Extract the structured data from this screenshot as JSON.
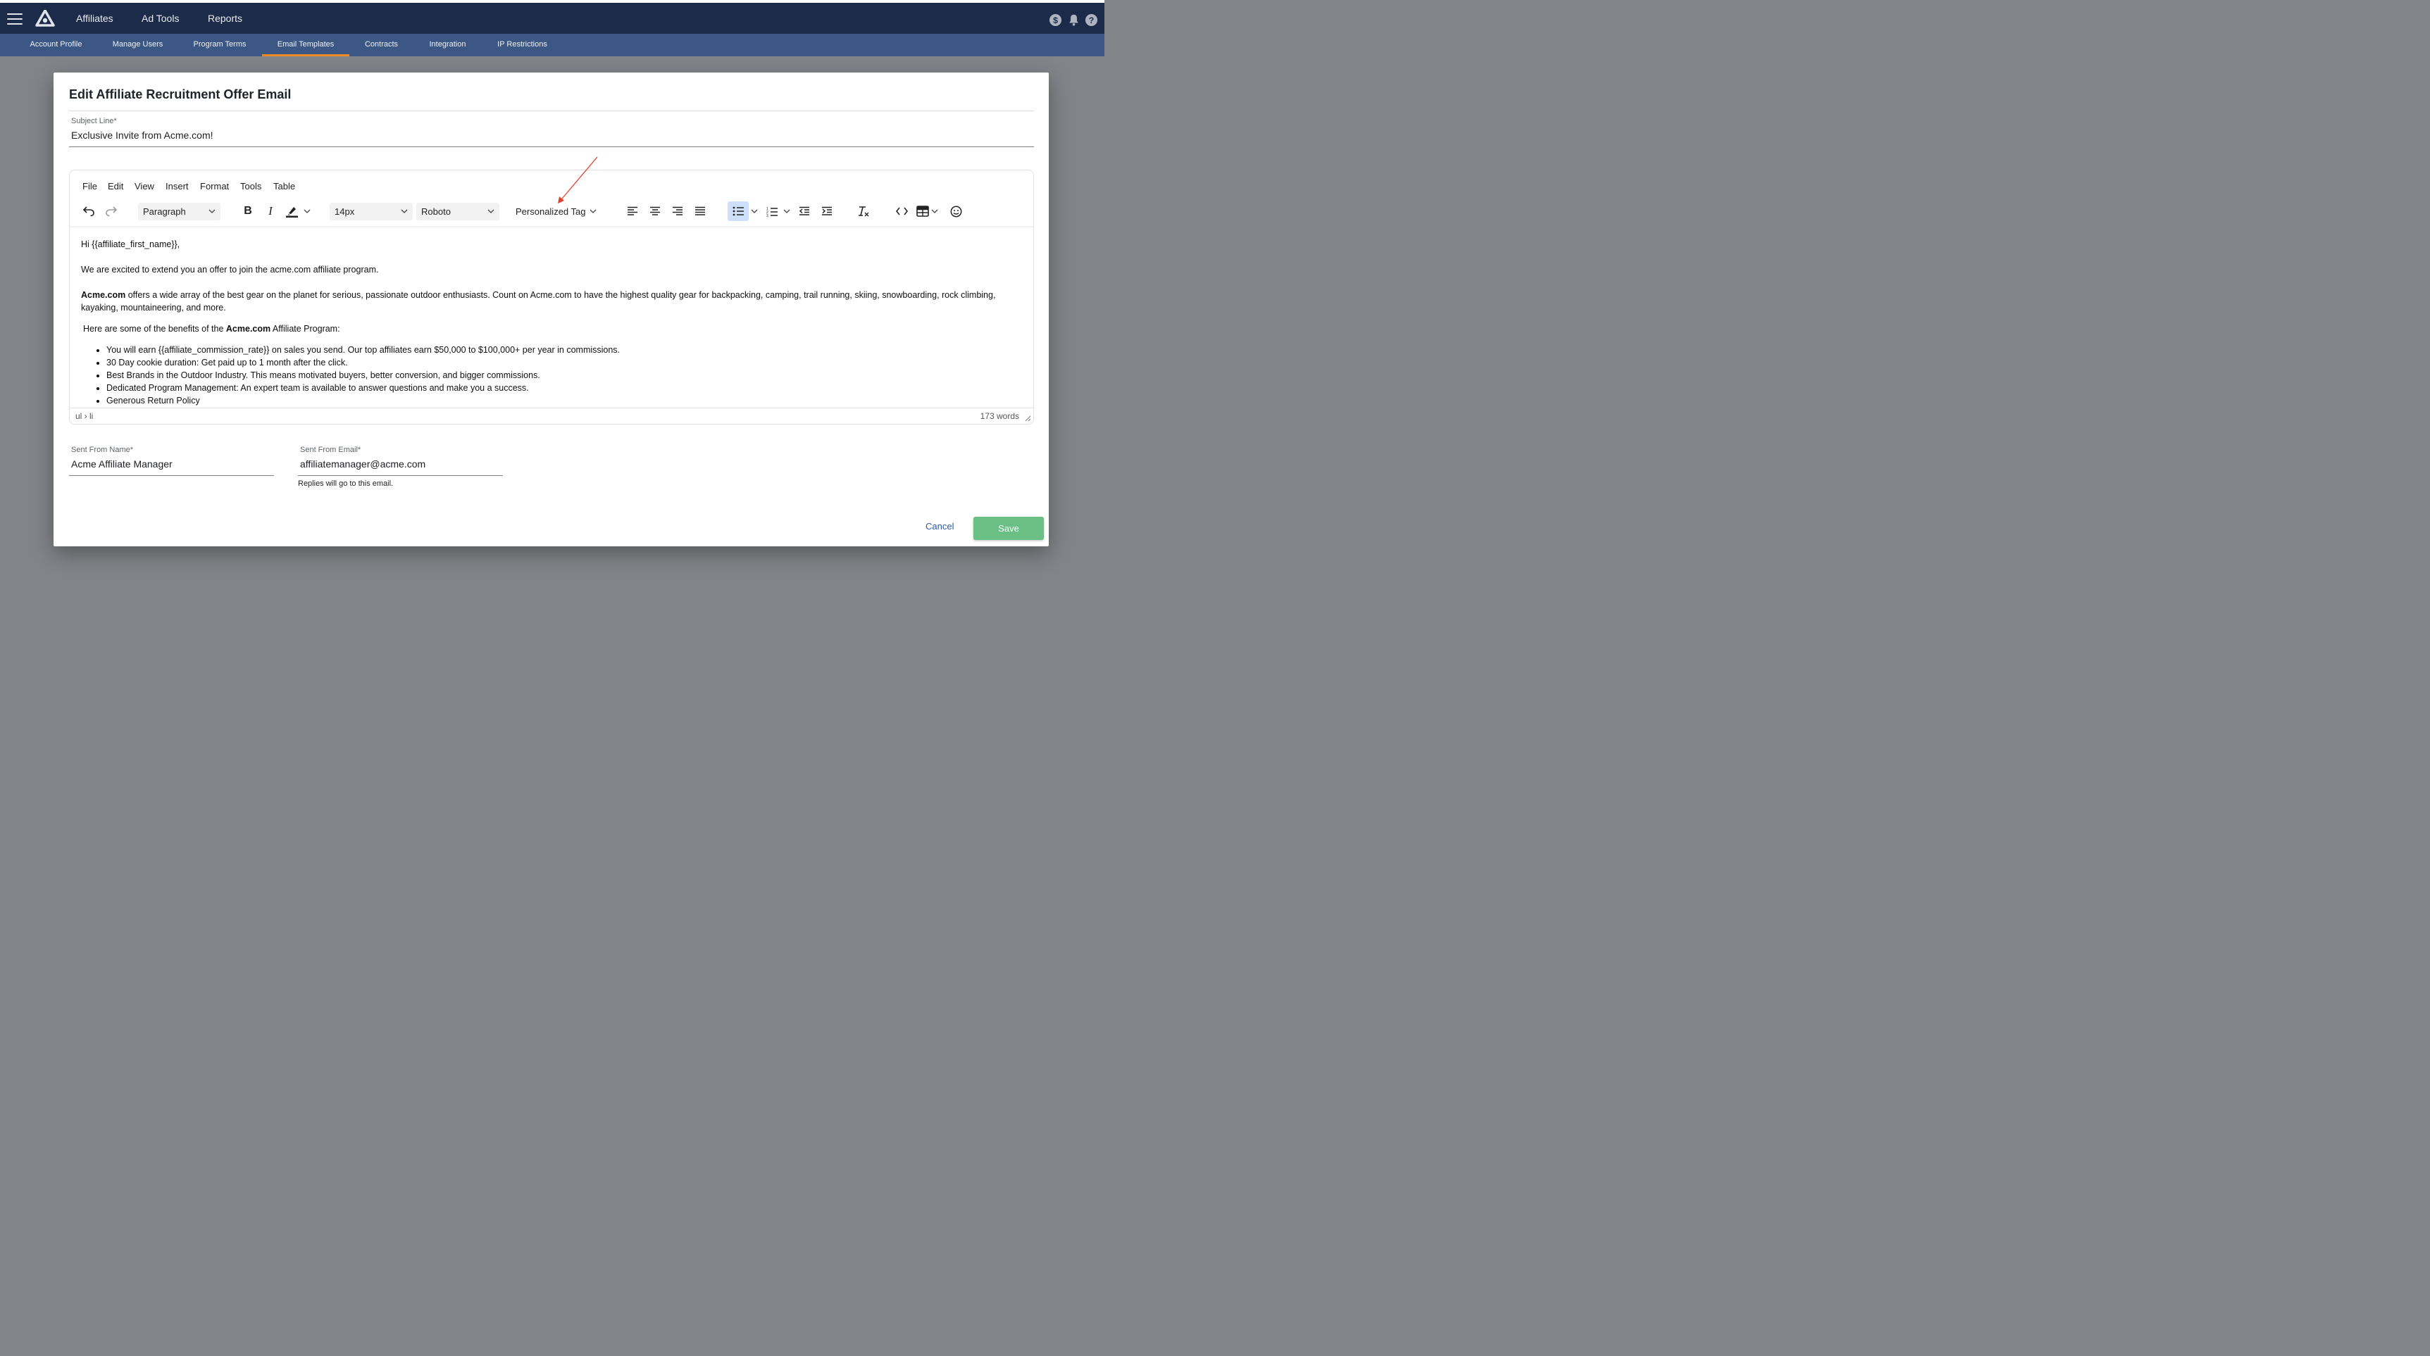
{
  "topbar": {
    "nav": [
      "Affiliates",
      "Ad Tools",
      "Reports"
    ],
    "icons": [
      "dollar-icon",
      "bell-icon",
      "help-icon"
    ]
  },
  "subnav": {
    "tabs": [
      "Account Profile",
      "Manage Users",
      "Program Terms",
      "Email Templates",
      "Contracts",
      "Integration",
      "IP Restrictions"
    ],
    "active": "Email Templates",
    "accent_color": "#f08a24"
  },
  "modal": {
    "title": "Edit Affiliate Recruitment Offer Email",
    "subject": {
      "label": "Subject Line*",
      "value": "Exclusive Invite from Acme.com!"
    },
    "editor": {
      "menu": [
        "File",
        "Edit",
        "View",
        "Insert",
        "Format",
        "Tools",
        "Table"
      ],
      "block_format": "Paragraph",
      "font_size": "14px",
      "font_family": "Roboto",
      "personalized_tag": "Personalized Tag",
      "content": {
        "greeting": "Hi {{affiliate_first_name}},",
        "intro": "We are excited to extend you an offer to join the acme.com affiliate program.",
        "brand": "Acme.com",
        "desc": " offers a wide array of the best gear on the planet for serious, passionate outdoor enthusiasts. Count on Acme.com to have the highest quality gear for backpacking, camping, trail running, skiing, snowboarding, rock climbing, kayaking, mountaineering, and more.",
        "benefits_pre": "Here are some of the benefits of the ",
        "benefits_brand": "Acme.com",
        "benefits_post": " Affiliate Program:",
        "bullets": [
          "You will earn {{affiliate_commission_rate}} on sales you send. Our top affiliates earn $50,000 to $100,000+ per year in commissions.",
          "30 Day cookie duration: Get paid up to 1 month after the click.",
          "Best Brands in the Outdoor Industry.  This means motivated buyers, better conversion, and bigger commissions.",
          "Dedicated Program Management: An expert team is available to answer questions and make you a success.",
          "Generous Return Policy"
        ]
      },
      "status_path": "ul › li",
      "word_count": "173 words"
    },
    "from_name": {
      "label": "Sent From Name*",
      "value": "Acme Affiliate Manager"
    },
    "from_email": {
      "label": "Sent From Email*",
      "value": "affiliatemanager@acme.com",
      "helper": "Replies will go to this email."
    },
    "cancel": "Cancel",
    "save": "Save",
    "save_color": "#6abf84"
  }
}
